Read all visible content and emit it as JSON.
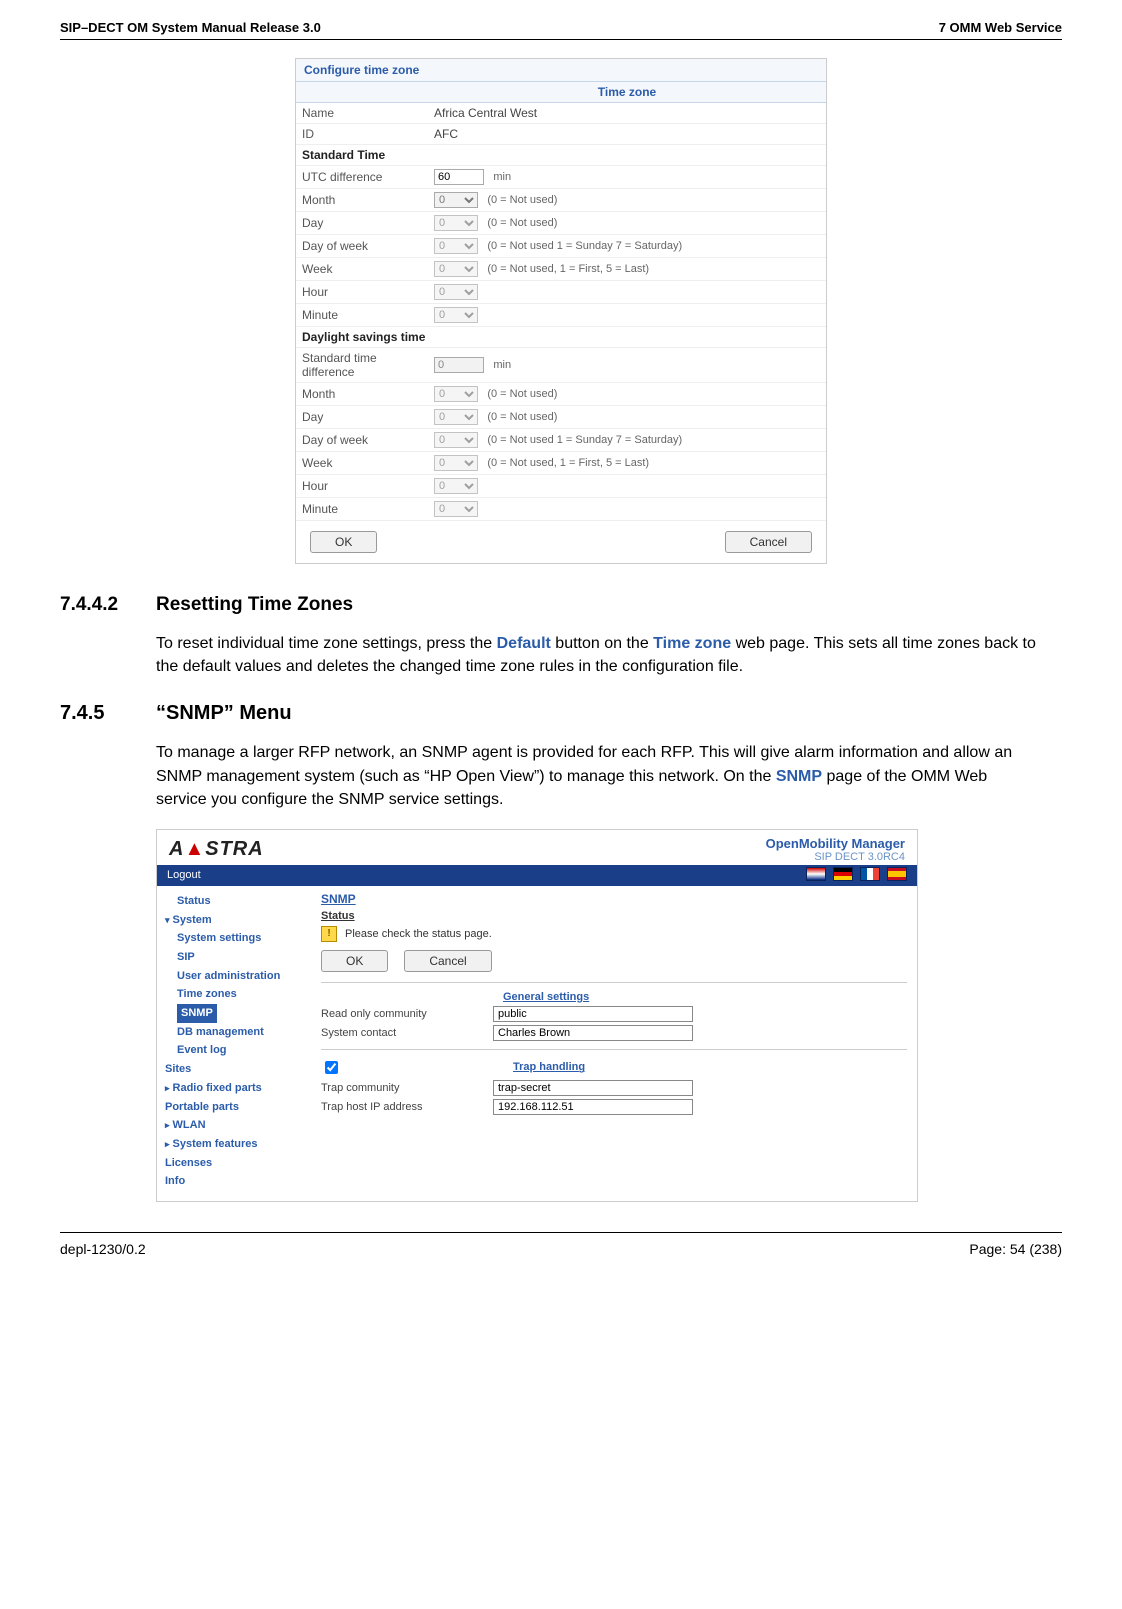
{
  "header": {
    "left": "SIP–DECT OM System Manual Release 3.0",
    "right": "7 OMM Web Service"
  },
  "footer": {
    "left": "depl-1230/0.2",
    "right": "Page: 54 (238)"
  },
  "dialog": {
    "title": "Configure time zone",
    "section_tz": "Time zone",
    "name_lbl": "Name",
    "name_val": "Africa Central West",
    "id_lbl": "ID",
    "id_val": "AFC",
    "std_hdr": "Standard Time",
    "utc_lbl": "UTC difference",
    "utc_val": "60",
    "utc_unit": "min",
    "mon_lbl": "Month",
    "mon_hint": "(0 = Not used)",
    "day_lbl": "Day",
    "day_hint": "(0 = Not used)",
    "dow_lbl": "Day of week",
    "dow_hint": "(0 = Not used 1 = Sunday 7 = Saturday)",
    "week_lbl": "Week",
    "week_hint": "(0 = Not used, 1 = First, 5 = Last)",
    "hour_lbl": "Hour",
    "min_lbl": "Minute",
    "dst_hdr": "Daylight savings time",
    "stdiff_lbl": "Standard time difference",
    "stdiff_val": "0",
    "stdiff_unit": "min",
    "sel0": "0",
    "ok": "OK",
    "cancel": "Cancel"
  },
  "h1": {
    "num": "7.4.4.2",
    "txt": "Resetting Time Zones"
  },
  "p1a": "To reset individual time zone settings, press the ",
  "p1b": "Default",
  "p1c": " button on the ",
  "p1d": "Time zone",
  "p1e": " web page. This sets all time zones back to the default values and deletes the changed time zone rules in the configuration file.",
  "h2": {
    "num": "7.4.5",
    "txt": "“SNMP” Menu"
  },
  "p2a": "To manage a larger RFP network, an SNMP agent is provided for each RFP. This will give alarm information and allow an SNMP management system (such as “HP Open View”) to manage this network. On the ",
  "p2b": "SNMP",
  "p2c": " page of the OMM Web service you configure the SNMP service settings.",
  "shot2": {
    "brand": "A  STRA",
    "om1": "OpenMobility Manager",
    "om2": "SIP DECT 3.0RC4",
    "logout": "Logout",
    "menu": {
      "status": "Status",
      "system": "System",
      "syss": "System settings",
      "sip": "SIP",
      "ua": "User administration",
      "tz": "Time zones",
      "snmp": "SNMP",
      "db": "DB management",
      "ev": "Event log",
      "sites": "Sites",
      "rfp": "Radio fixed parts",
      "pp": "Portable parts",
      "wlan": "WLAN",
      "sf": "System features",
      "lic": "Licenses",
      "info": "Info"
    },
    "page_title": "SNMP",
    "status_hdr": "Status",
    "status_msg": "Please check the status page.",
    "ok": "OK",
    "cancel": "Cancel",
    "gen_hdr": "General settings",
    "roc_lbl": "Read only community",
    "roc_val": "public",
    "sc_lbl": "System contact",
    "sc_val": "Charles Brown",
    "trap_hdr": "Trap handling",
    "tc_lbl": "Trap community",
    "tc_val": "trap-secret",
    "th_lbl": "Trap host IP address",
    "th_val": "192.168.112.51"
  }
}
